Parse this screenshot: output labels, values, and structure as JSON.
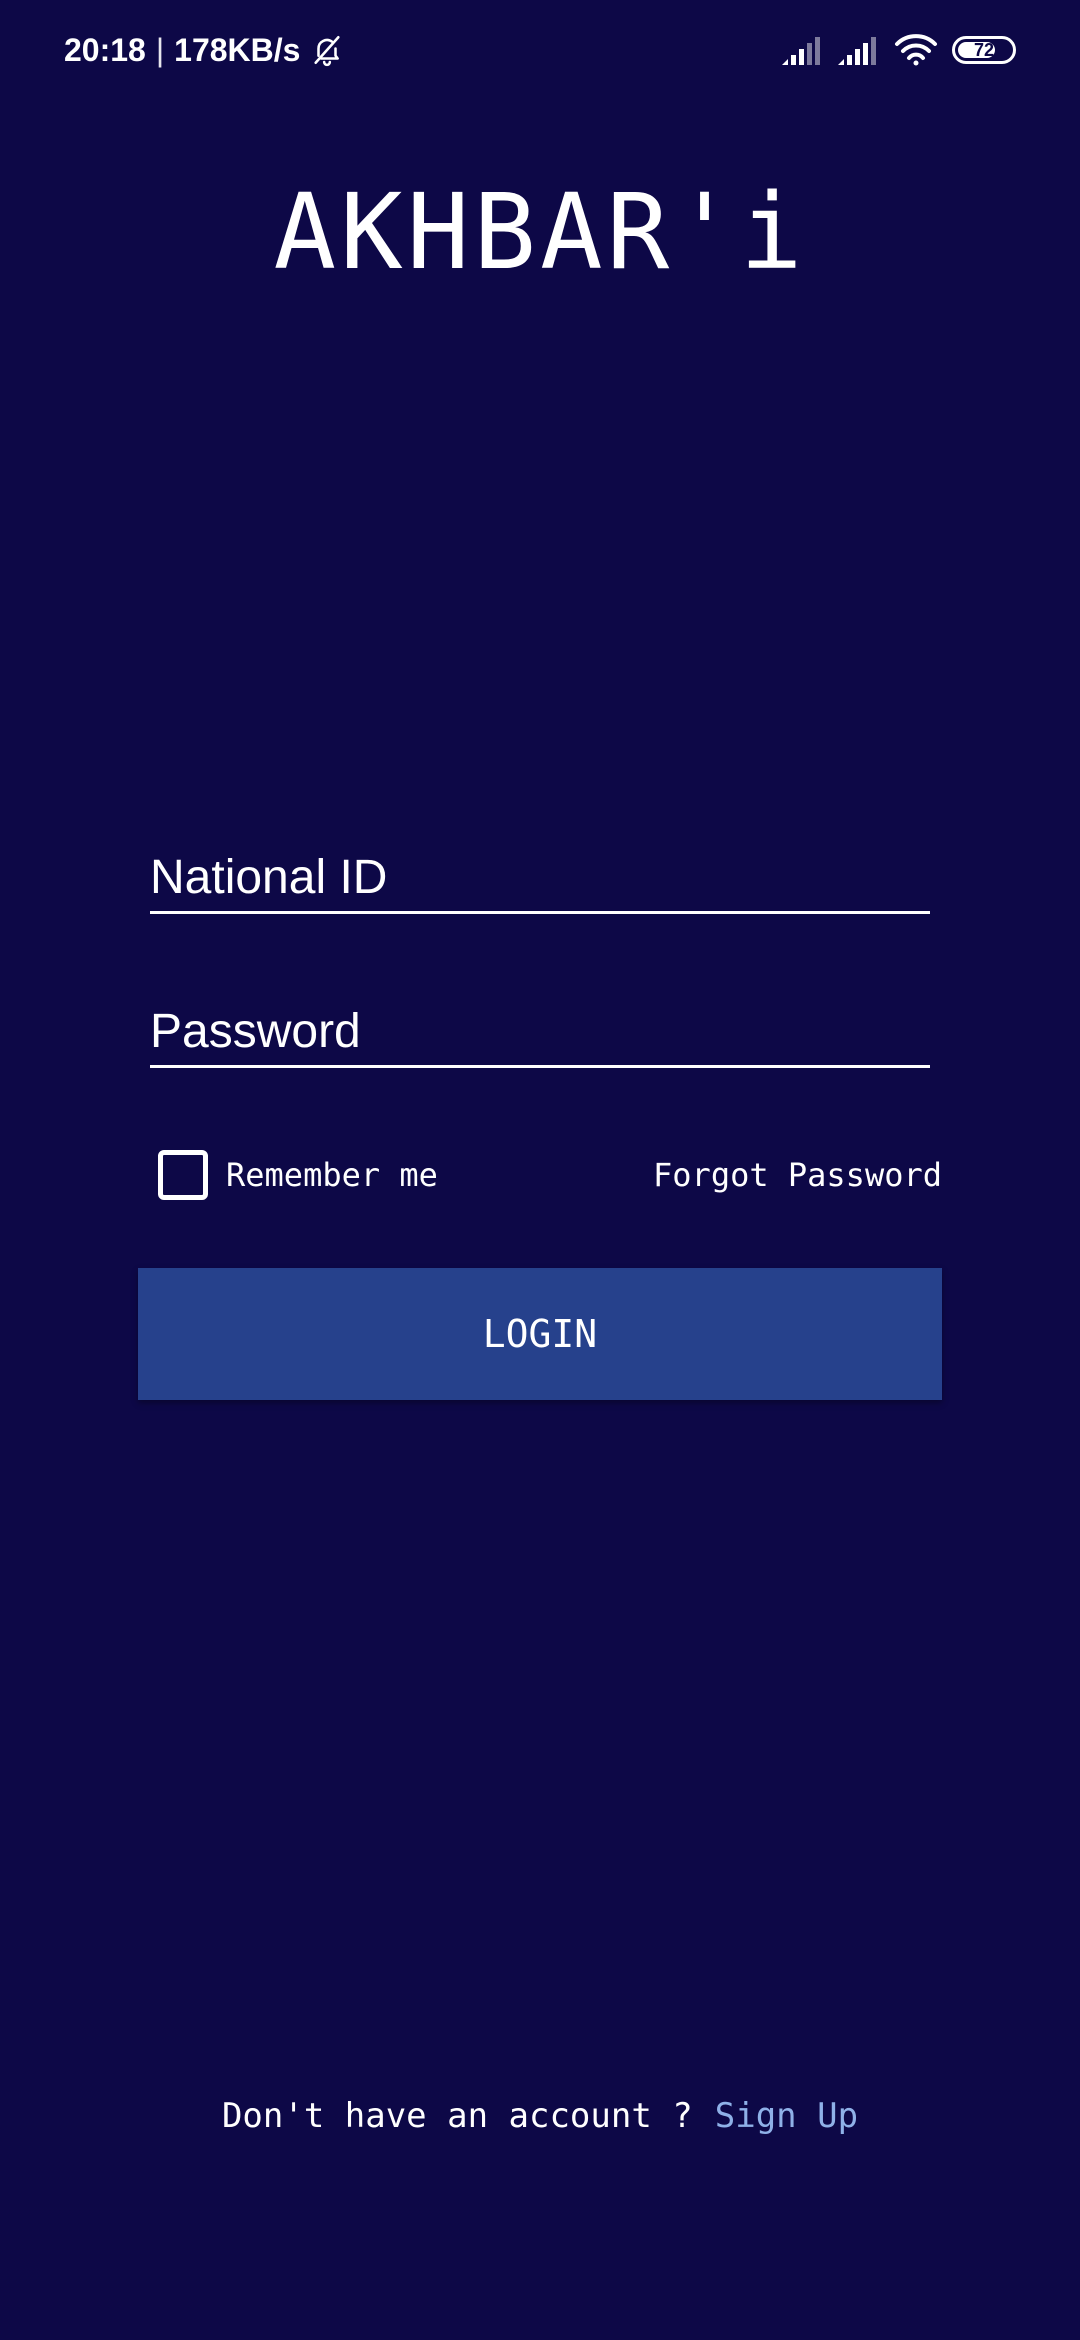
{
  "status_bar": {
    "time": "20:18",
    "separator": "|",
    "network_speed": "178KB/s",
    "notification_icon": "bell-muted-icon",
    "signal_icons": [
      "cell-signal-icon",
      "cell-signal-icon"
    ],
    "wifi_icon": "wifi-icon",
    "battery_level": "72",
    "battery_fraction": 0.72
  },
  "app": {
    "title": "AKHBAR'i"
  },
  "login_form": {
    "national_id_placeholder": "National ID",
    "national_id_value": "",
    "password_placeholder": "Password",
    "password_value": "",
    "remember_me_label": "Remember me",
    "remember_me_checked": false,
    "forgot_password_label": "Forgot Password",
    "login_button_label": "LOGIN"
  },
  "signup": {
    "prompt": "Don't have an account ?",
    "link_label": "Sign Up"
  },
  "colors": {
    "background": "#0d0847",
    "button": "#26418c",
    "link": "#8fb1e8",
    "text": "#ffffff"
  }
}
